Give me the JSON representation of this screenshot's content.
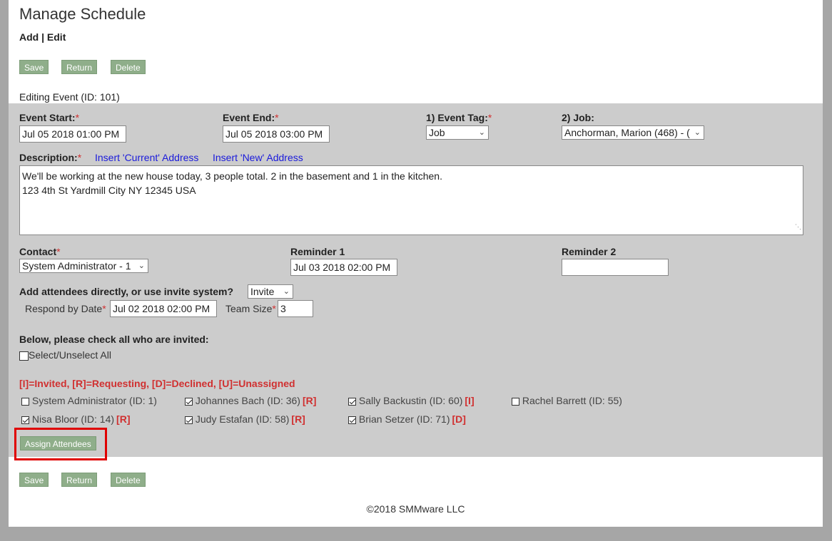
{
  "header": {
    "title": "Manage Schedule",
    "subnav": "Add | Edit"
  },
  "toolbar": {
    "save_label": "Save",
    "return_label": "Return",
    "delete_label": "Delete"
  },
  "editing_label": "Editing Event (ID: 101)",
  "required_mark": "*",
  "form": {
    "event_start": {
      "label": "Event Start:",
      "value": "Jul 05 2018 01:00 PM"
    },
    "event_end": {
      "label": "Event End:",
      "value": "Jul 05 2018 03:00 PM"
    },
    "event_tag": {
      "label": "1) Event Tag:",
      "value": "Job"
    },
    "job": {
      "label": "2) Job:",
      "value": "Anchorman, Marion (468) - ("
    },
    "description": {
      "label": "Description:",
      "insert_current": "Insert 'Current' Address",
      "insert_new": "Insert 'New' Address",
      "line1": "We'll be working at the new house today, 3 people total. 2 in the basement and 1 in the kitchen.",
      "line2": "123 4th St  Yardmill City NY 12345 USA"
    },
    "contact": {
      "label": "Contact",
      "value": "System Administrator - 1"
    },
    "reminder1": {
      "label": "Reminder 1",
      "value": "Jul 03 2018 02:00 PM"
    },
    "reminder2": {
      "label": "Reminder 2",
      "value": ""
    },
    "attendee_mode": {
      "label": "Add attendees directly, or use invite system?",
      "value": "Invite"
    },
    "respond_by": {
      "label": "Respond by Date",
      "value": "Jul 02 2018 02:00 PM"
    },
    "team_size": {
      "label": "Team Size",
      "value": "3"
    }
  },
  "invite": {
    "heading": "Below, please check all who are invited:",
    "select_all": "Select/Unselect All",
    "legend": "[I]=Invited, [R]=Requesting, [D]=Declined, [U]=Unassigned",
    "attendees": [
      {
        "name": "System Administrator (ID: 1)",
        "checked": false,
        "tag": ""
      },
      {
        "name": "Johannes Bach (ID: 36)",
        "checked": true,
        "tag": "[R]"
      },
      {
        "name": "Sally Backustin (ID: 60)",
        "checked": true,
        "tag": "[I]"
      },
      {
        "name": "Rachel Barrett (ID: 55)",
        "checked": false,
        "tag": ""
      },
      {
        "name": "Nisa Bloor (ID: 14)",
        "checked": true,
        "tag": "[R]"
      },
      {
        "name": "Judy Estafan (ID: 58)",
        "checked": true,
        "tag": "[R]"
      },
      {
        "name": "Brian Setzer (ID: 71)",
        "checked": true,
        "tag": "[D]"
      }
    ],
    "assign_label": "Assign Attendees"
  },
  "footer": {
    "copyright": "©2018 SMMware LLC"
  },
  "colors": {
    "button_green": "#8fae8a",
    "panel_gray": "#cccccc",
    "required_red": "#d03030",
    "link_blue": "#1a1adb",
    "highlight_red": "#e00000"
  }
}
